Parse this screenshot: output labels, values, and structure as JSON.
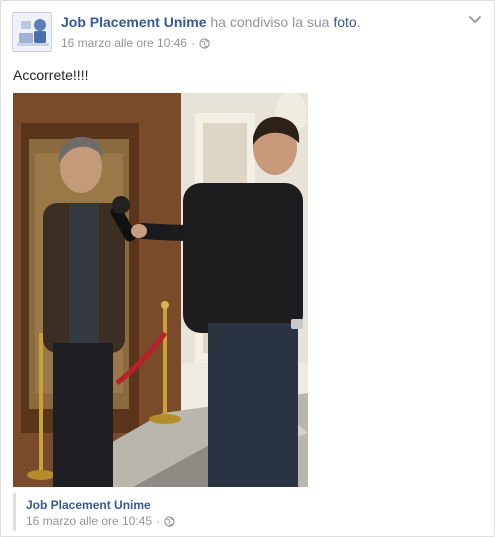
{
  "post": {
    "author": "Job Placement Unime",
    "action_prefix": "ha condiviso la sua ",
    "action_link": "foto",
    "action_suffix": ".",
    "timestamp": "16 marzo alle ore 10:46",
    "separator": "·",
    "privacy_icon": "globe-icon",
    "menu_icon": "chevron-down-icon",
    "text": "Accorrete!!!!"
  },
  "shared": {
    "author": "Job Placement Unime",
    "timestamp": "16 marzo alle ore 10:45",
    "separator": "·",
    "privacy_icon": "globe-icon"
  },
  "colors": {
    "link": "#365899",
    "meta": "#90949c",
    "text": "#1d2129",
    "border": "#dddfe2"
  }
}
